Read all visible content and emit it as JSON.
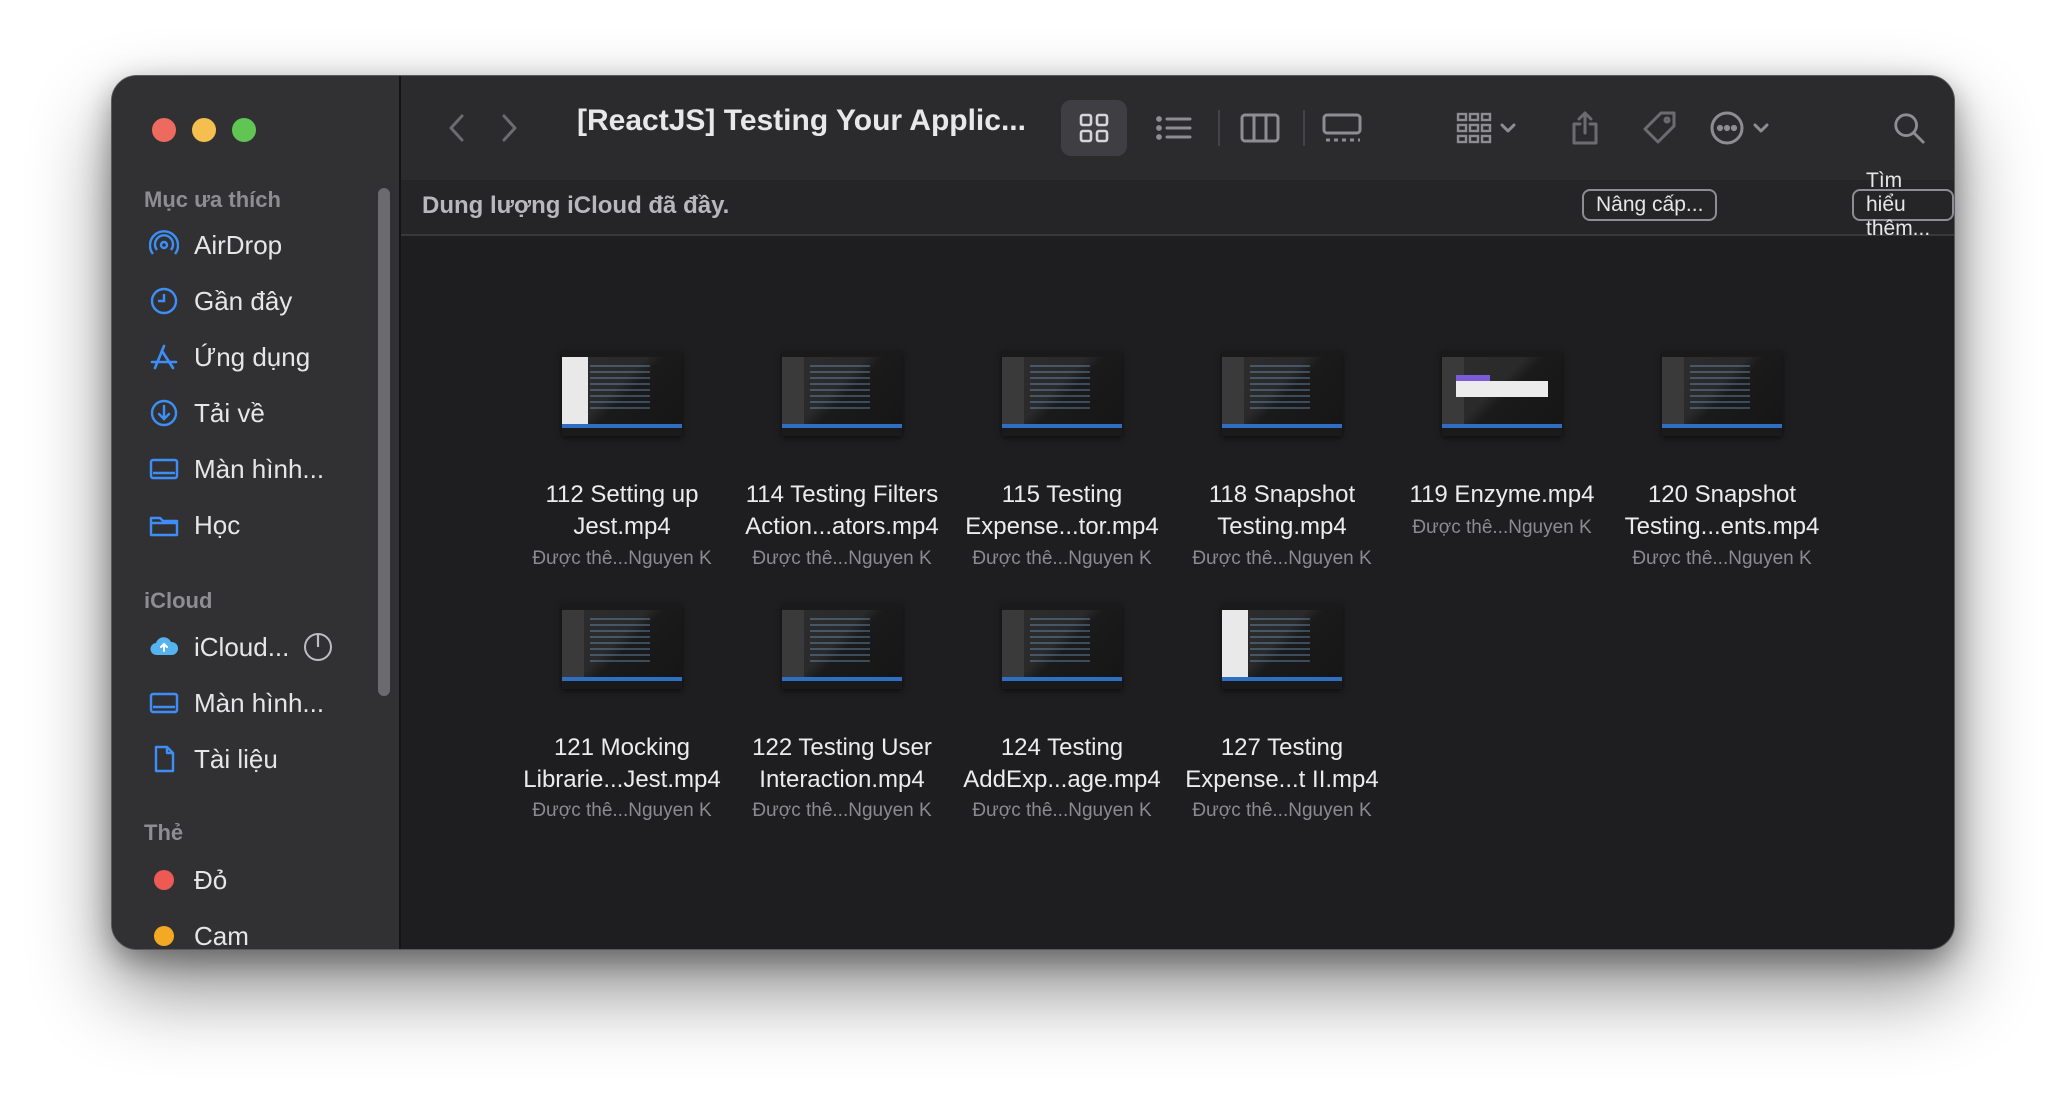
{
  "window": {
    "title": "[ReactJS] Testing Your Applic..."
  },
  "sidebar": {
    "favorites_header": "Mục ưa thích",
    "favorites": [
      {
        "label": "AirDrop",
        "icon": "airdrop-icon"
      },
      {
        "label": "Gần đây",
        "icon": "clock-icon"
      },
      {
        "label": "Ứng dụng",
        "icon": "applications-icon"
      },
      {
        "label": "Tải về",
        "icon": "download-icon"
      },
      {
        "label": "Màn hình...",
        "icon": "desktop-icon"
      },
      {
        "label": "Học",
        "icon": "folder-icon"
      }
    ],
    "icloud_header": "iCloud",
    "icloud": [
      {
        "label": "iCloud...",
        "icon": "icloud-icon"
      },
      {
        "label": "Màn hình...",
        "icon": "desktop-icon"
      },
      {
        "label": "Tài liệu",
        "icon": "document-icon"
      }
    ],
    "tags_header": "Thẻ",
    "tags": [
      {
        "label": "Đỏ",
        "color": "#ec5a53"
      },
      {
        "label": "Cam",
        "color": "#f3a923"
      }
    ]
  },
  "banner": {
    "text": "Dung lượng iCloud đã đầy.",
    "upgrade_label": "Nâng cấp...",
    "learn_more_label": "Tìm hiểu thêm..."
  },
  "files": [
    {
      "name_line1": "112 Setting up",
      "name_line2": "Jest.mp4",
      "subtitle": "Được thê...Nguyen K",
      "thumb": "light"
    },
    {
      "name_line1": "114 Testing Filters",
      "name_line2": "Action...ators.mp4",
      "subtitle": "Được thê...Nguyen K",
      "thumb": "dark"
    },
    {
      "name_line1": "115 Testing",
      "name_line2": "Expense...tor.mp4",
      "subtitle": "Được thê...Nguyen K",
      "thumb": "dark"
    },
    {
      "name_line1": "118 Snapshot",
      "name_line2": "Testing.mp4",
      "subtitle": "Được thê...Nguyen K",
      "thumb": "dark"
    },
    {
      "name_line1": "119 Enzyme.mp4",
      "name_line2": "",
      "subtitle": "Được thê...Nguyen K",
      "thumb": "dialog"
    },
    {
      "name_line1": "120 Snapshot",
      "name_line2": "Testing...ents.mp4",
      "subtitle": "Được thê...Nguyen K",
      "thumb": "dark"
    },
    {
      "name_line1": "121 Mocking",
      "name_line2": "Librarie...Jest.mp4",
      "subtitle": "Được thê...Nguyen K",
      "thumb": "dark"
    },
    {
      "name_line1": "122 Testing User",
      "name_line2": "Interaction.mp4",
      "subtitle": "Được thê...Nguyen K",
      "thumb": "dark"
    },
    {
      "name_line1": "124 Testing",
      "name_line2": "AddExp...age.mp4",
      "subtitle": "Được thê...Nguyen K",
      "thumb": "dark"
    },
    {
      "name_line1": "127 Testing",
      "name_line2": "Expense...t II.mp4",
      "subtitle": "Được thê...Nguyen K",
      "thumb": "light"
    }
  ]
}
